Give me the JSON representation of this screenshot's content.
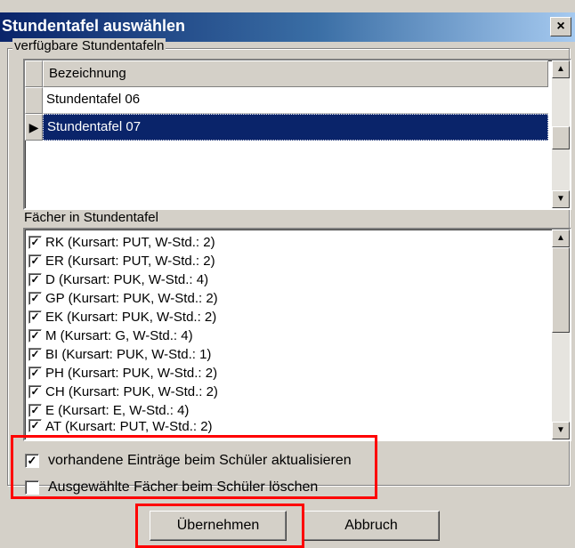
{
  "window": {
    "title": "Stundentafel auswählen",
    "close_glyph": "×"
  },
  "group": {
    "label": "verfügbare Stundentafeln"
  },
  "grid": {
    "column_header": "Bezeichnung",
    "rows": [
      {
        "label": "Stundentafel 06",
        "selected": false
      },
      {
        "label": "Stundentafel 07",
        "selected": true
      }
    ]
  },
  "subjects": {
    "label": "Fächer in Stundentafel",
    "items": [
      "RK (Kursart: PUT, W-Std.: 2)",
      "ER (Kursart: PUT, W-Std.: 2)",
      "D (Kursart: PUK, W-Std.: 4)",
      "GP (Kursart: PUK, W-Std.: 2)",
      "EK (Kursart: PUK, W-Std.: 2)",
      "M (Kursart: G, W-Std.: 4)",
      "BI (Kursart: PUK, W-Std.: 1)",
      "PH (Kursart: PUK, W-Std.: 2)",
      "CH (Kursart: PUK, W-Std.: 2)",
      "E (Kursart: E, W-Std.: 4)",
      "AT (Kursart: PUT, W-Std.: 2)"
    ]
  },
  "options": {
    "update_label": "vorhandene Einträge beim Schüler aktualisieren",
    "update_checked": true,
    "delete_label": "Ausgewählte Fächer beim Schüler löschen",
    "delete_checked": false
  },
  "buttons": {
    "apply": "Übernehmen",
    "cancel": "Abbruch"
  },
  "colors": {
    "highlight": "#ff0000",
    "selection": "#0a246a",
    "title_start": "#0a246a"
  }
}
